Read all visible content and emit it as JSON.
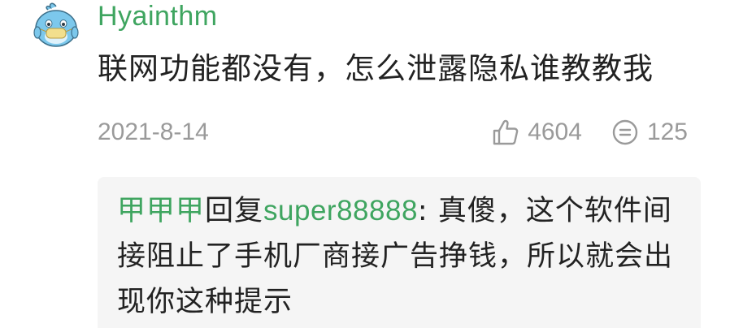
{
  "comment": {
    "username": "Hyainthm",
    "text": "联网功能都没有，怎么泄露隐私谁教教我",
    "date": "2021-8-14",
    "likes": "4604",
    "replies": "125",
    "like_icon": "thumbs-up-icon",
    "reply_icon": "comment-bubble-icon",
    "avatar_icon": "blue-bird-avatar"
  },
  "reply": {
    "author": "甲甲甲",
    "verb": "回复",
    "target": "super88888",
    "separator": ": ",
    "text": "真傻，这个软件间接阻止了手机厂商接广告挣钱，所以就会出现你这种提示"
  },
  "colors": {
    "accent_green": "#3fa560",
    "text": "#222222",
    "muted": "#9a9a9a",
    "reply_bg": "#f5f5f5",
    "avatar_blue": "#7cc8ec"
  }
}
